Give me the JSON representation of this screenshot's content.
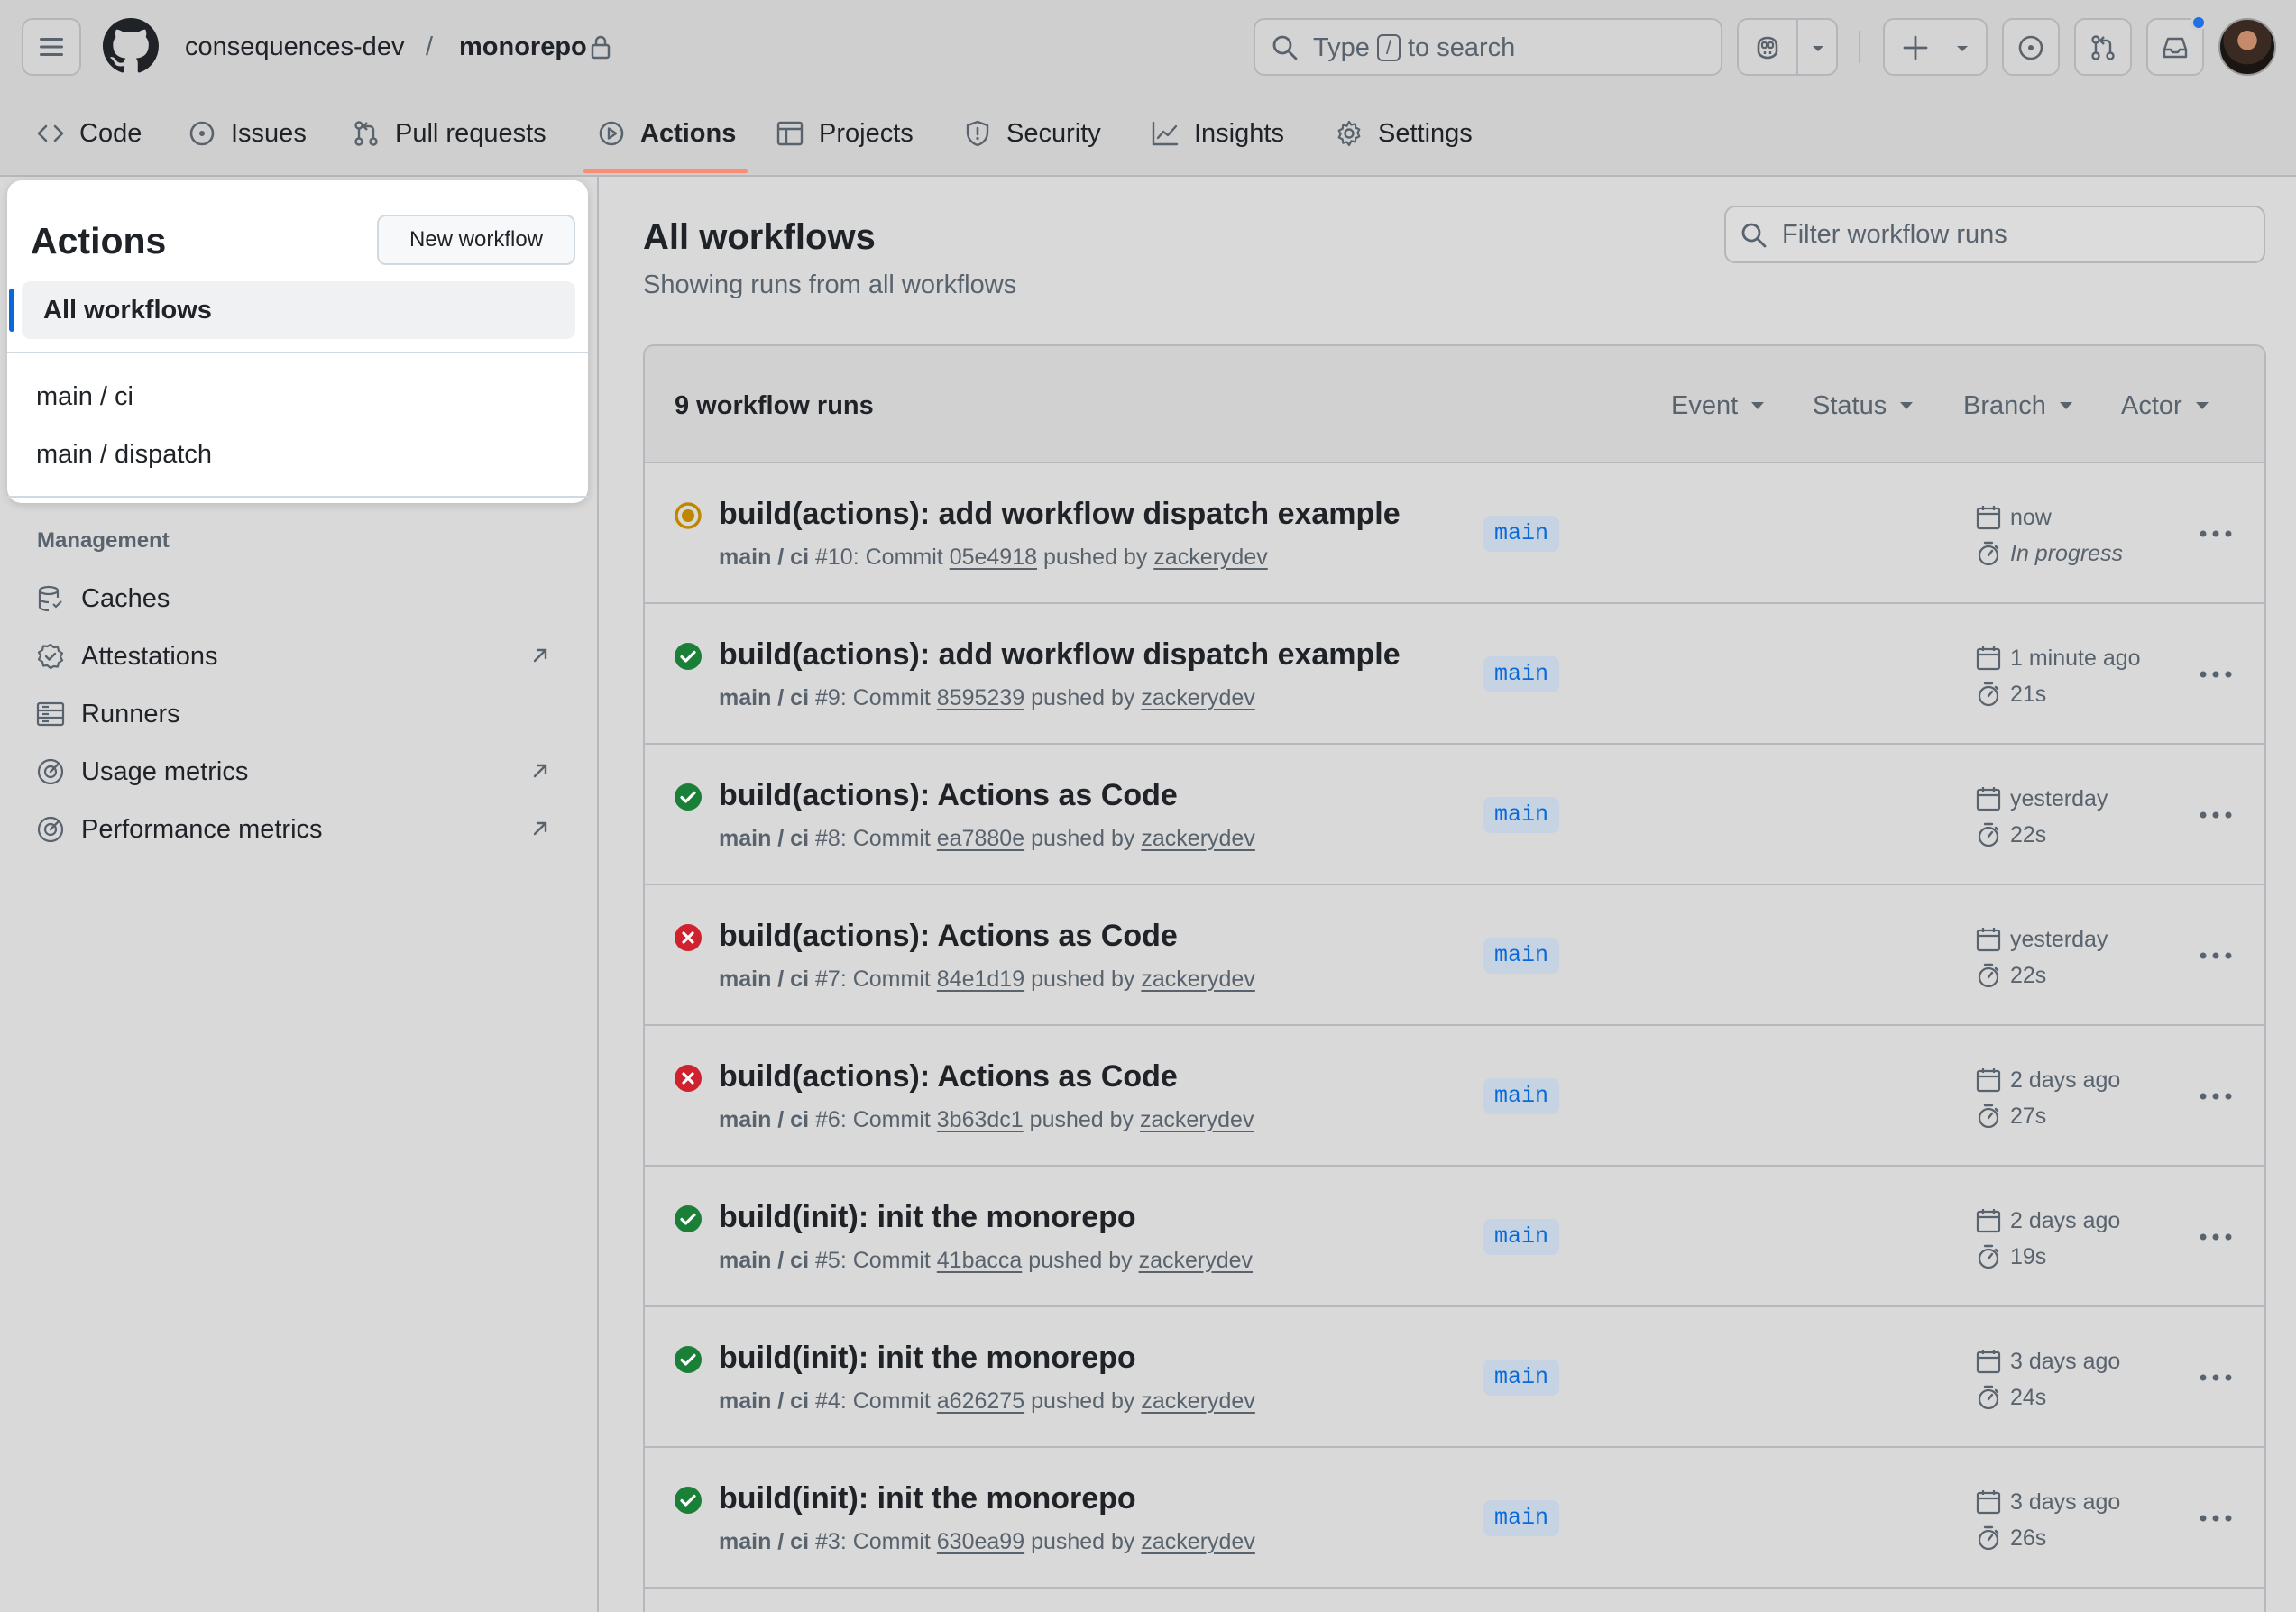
{
  "header": {
    "owner": "consequences-dev",
    "separator": "/",
    "repo": "monorepo",
    "search": {
      "prefix": "Type",
      "key": "/",
      "suffix": "to search"
    }
  },
  "nav": {
    "tabs": [
      {
        "label": "Code",
        "icon": "code-icon"
      },
      {
        "label": "Issues",
        "icon": "issue-icon"
      },
      {
        "label": "Pull requests",
        "icon": "pull-request-icon"
      },
      {
        "label": "Actions",
        "icon": "play-icon",
        "active": true
      },
      {
        "label": "Projects",
        "icon": "table-icon"
      },
      {
        "label": "Security",
        "icon": "shield-icon"
      },
      {
        "label": "Insights",
        "icon": "graph-icon"
      },
      {
        "label": "Settings",
        "icon": "gear-icon"
      }
    ]
  },
  "sidebar": {
    "title": "Actions",
    "new_workflow_label": "New workflow",
    "all_workflows_label": "All workflows",
    "workflows": [
      "main / ci",
      "main / dispatch"
    ],
    "management_heading": "Management",
    "management_items": [
      {
        "label": "Caches",
        "icon": "database-icon",
        "external": false
      },
      {
        "label": "Attestations",
        "icon": "verified-icon",
        "external": true
      },
      {
        "label": "Runners",
        "icon": "server-icon",
        "external": false
      },
      {
        "label": "Usage metrics",
        "icon": "meter-icon",
        "external": true
      },
      {
        "label": "Performance metrics",
        "icon": "meter-icon",
        "external": true
      }
    ]
  },
  "main": {
    "title": "All workflows",
    "subtitle": "Showing runs from all workflows",
    "filter_placeholder": "Filter workflow runs",
    "runs_count": "9 workflow runs",
    "filters": [
      "Event",
      "Status",
      "Branch",
      "Actor"
    ],
    "runs": [
      {
        "status": "in_progress",
        "title": "build(actions): add workflow dispatch example",
        "workflow": "main / ci",
        "number": "#10",
        "commit_label": "Commit",
        "commit": "05e4918",
        "pushed_by": "pushed by",
        "actor": "zackerydev",
        "branch": "main",
        "when": "now",
        "duration": "In progress"
      },
      {
        "status": "success",
        "title": "build(actions): add workflow dispatch example",
        "workflow": "main / ci",
        "number": "#9",
        "commit_label": "Commit",
        "commit": "8595239",
        "pushed_by": "pushed by",
        "actor": "zackerydev",
        "branch": "main",
        "when": "1 minute ago",
        "duration": "21s"
      },
      {
        "status": "success",
        "title": "build(actions): Actions as Code",
        "workflow": "main / ci",
        "number": "#8",
        "commit_label": "Commit",
        "commit": "ea7880e",
        "pushed_by": "pushed by",
        "actor": "zackerydev",
        "branch": "main",
        "when": "yesterday",
        "duration": "22s"
      },
      {
        "status": "failure",
        "title": "build(actions): Actions as Code",
        "workflow": "main / ci",
        "number": "#7",
        "commit_label": "Commit",
        "commit": "84e1d19",
        "pushed_by": "pushed by",
        "actor": "zackerydev",
        "branch": "main",
        "when": "yesterday",
        "duration": "22s"
      },
      {
        "status": "failure",
        "title": "build(actions): Actions as Code",
        "workflow": "main / ci",
        "number": "#6",
        "commit_label": "Commit",
        "commit": "3b63dc1",
        "pushed_by": "pushed by",
        "actor": "zackerydev",
        "branch": "main",
        "when": "2 days ago",
        "duration": "27s"
      },
      {
        "status": "success",
        "title": "build(init): init the monorepo",
        "workflow": "main / ci",
        "number": "#5",
        "commit_label": "Commit",
        "commit": "41bacca",
        "pushed_by": "pushed by",
        "actor": "zackerydev",
        "branch": "main",
        "when": "2 days ago",
        "duration": "19s"
      },
      {
        "status": "success",
        "title": "build(init): init the monorepo",
        "workflow": "main / ci",
        "number": "#4",
        "commit_label": "Commit",
        "commit": "a626275",
        "pushed_by": "pushed by",
        "actor": "zackerydev",
        "branch": "main",
        "when": "3 days ago",
        "duration": "24s"
      },
      {
        "status": "success",
        "title": "build(init): init the monorepo",
        "workflow": "main / ci",
        "number": "#3",
        "commit_label": "Commit",
        "commit": "630ea99",
        "pushed_by": "pushed by",
        "actor": "zackerydev",
        "branch": "main",
        "when": "3 days ago",
        "duration": "26s"
      }
    ]
  },
  "colors": {
    "accent": "#0969da",
    "success": "#1a7f37",
    "failure": "#cf222e",
    "in_progress": "#bf8700",
    "tab_underline": "#fd8c73"
  }
}
